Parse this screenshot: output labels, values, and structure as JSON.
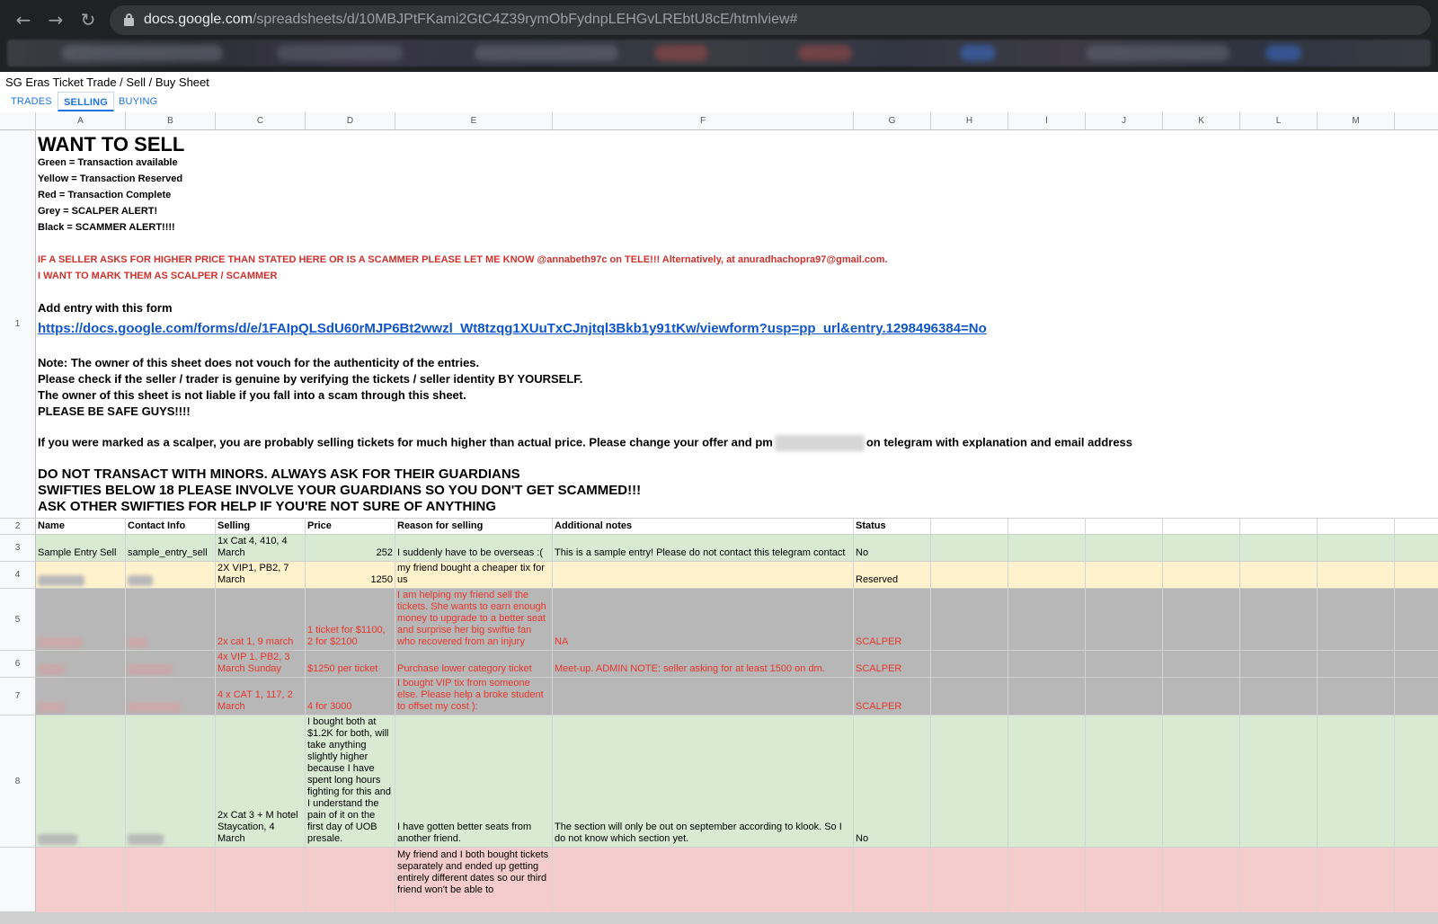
{
  "browser": {
    "url_host": "docs.google.com",
    "url_path": "/spreadsheets/d/10MBJPtFKami2GtC4Z39rymObFydnpLEHGvLREbtU8cE/htmlview#",
    "back_icon": "arrow-left",
    "forward_icon": "arrow-right",
    "reload_icon": "reload"
  },
  "sheet": {
    "title": "SG Eras Ticket Trade / Sell / Buy Sheet",
    "tabs": [
      {
        "label": "TRADES",
        "active": false
      },
      {
        "label": "SELLING",
        "active": true
      },
      {
        "label": "BUYING",
        "active": false
      }
    ],
    "columns": [
      "A",
      "B",
      "C",
      "D",
      "E",
      "F",
      "G",
      "H",
      "I",
      "J",
      "K",
      "L",
      "M"
    ],
    "row_numbers": [
      "1",
      "2",
      "3",
      "4",
      "5",
      "6",
      "7",
      "8"
    ]
  },
  "intro": {
    "heading": "WANT TO SELL",
    "legend": [
      "Green = Transaction available",
      "Yellow = Transaction Reserved",
      "Red = Transaction Complete",
      "Grey = SCALPER ALERT!",
      "Black = SCAMMER ALERT!!!!"
    ],
    "warning_1": "IF A SELLER ASKS FOR HIGHER PRICE THAN STATED HERE OR IS A SCAMMER PLEASE LET ME KNOW @annabeth97c on TELE!!! Alternatively, at anuradhachopra97@gmail.com.",
    "warning_2": "I WANT TO MARK THEM AS SCALPER / SCAMMER",
    "form_label": "Add entry with this form",
    "form_link": "https://docs.google.com/forms/d/e/1FAIpQLSdU60rMJP6Bt2wwzl_Wt8tzqg1XUuTxCJnjtql3Bkb1y91tKw/viewform?usp=pp_url&entry.1298496384=No",
    "notes": [
      "Note: The owner of this sheet does not vouch for the authenticity of the entries.",
      "Please check if the seller / trader is genuine by verifying the tickets / seller identity BY YOURSELF.",
      "The owner of this sheet is not liable if you fall into a scam through this sheet.",
      "PLEASE BE SAFE GUYS!!!!"
    ],
    "scalper_note_before": "If you were marked as a scalper, you are probably selling tickets for much higher than actual price. Please change your offer and pm",
    "scalper_note_after": "on telegram with explanation and email address",
    "shout": [
      "DO NOT TRANSACT WITH MINORS. ALWAYS ASK FOR THEIR GUARDIANS",
      "SWIFTIES BELOW 18 PLEASE INVOLVE YOUR GUARDIANS SO YOU DON'T GET SCAMMED!!!",
      "ASK OTHER SWIFTIES FOR HELP IF YOU'RE NOT SURE OF ANYTHING"
    ]
  },
  "table": {
    "headers": [
      "Name",
      "Contact Info",
      "Selling",
      "Price",
      "Reason for selling",
      "Additional notes",
      "Status"
    ],
    "rows": [
      {
        "name": "Sample Entry Sell",
        "contact": "sample_entry_sell",
        "selling": "1x Cat 4, 410, 4 March",
        "price": "252",
        "reason": "I suddenly have to be overseas :(",
        "notes": "This is a sample entry! Please do not contact this telegram contact",
        "status": "No"
      },
      {
        "name": "",
        "contact": "",
        "selling": "2X VIP1, PB2, 7 March",
        "price": "1250",
        "reason": "my friend bought a cheaper tix for us",
        "notes": "",
        "status": "Reserved"
      },
      {
        "name": "",
        "contact": "",
        "selling": "2x cat 1, 9 march",
        "price": "1 ticket for $1100, 2 for $2100",
        "reason": "I am helping my friend sell the tickets. She wants to earn enough money to upgrade to a better seat and surprise her big swiftie fan who recovered from an injury",
        "notes": "NA",
        "status": "SCALPER"
      },
      {
        "name": "",
        "contact": "",
        "selling": "4x VIP 1, PB2, 3 March Sunday",
        "price": "$1250 per ticket",
        "reason": "Purchase lower category ticket",
        "notes": "Meet-up. ADMIN NOTE: seller asking for at least 1500 on dm.",
        "status": "SCALPER"
      },
      {
        "name": "",
        "contact": "",
        "selling": "4 x CAT 1, 117, 2 March",
        "price": "4 for 3000",
        "reason": "I bought VIP tix from someone else. Please help a broke student to offset my cost ):",
        "notes": "",
        "status": "SCALPER"
      },
      {
        "name": "",
        "contact": "",
        "selling": "2x Cat 3 + M hotel Staycation, 4 March",
        "price": "I bought both at $1.2K for both, will take anything slightly higher because I have spent long hours fighting for this and I understand the pain of it on the first day of UOB presale.",
        "reason": "I have gotten better seats from another friend.",
        "notes": "The section will only be out on september according to klook. So I do not know which section yet.",
        "status": "No"
      },
      {
        "name": "",
        "contact": "",
        "selling": "",
        "price": "",
        "reason": "My friend and I both bought tickets separately and ended up getting entirely different dates so our third friend won't be able to",
        "notes": "",
        "status": ""
      }
    ]
  },
  "colors": {
    "green": "#d9ead3",
    "yellow": "#fff2cc",
    "grey": "#b7b7b7",
    "pink": "#f4cccc",
    "scalper_text": "#e8362b",
    "link": "#1155cc"
  }
}
